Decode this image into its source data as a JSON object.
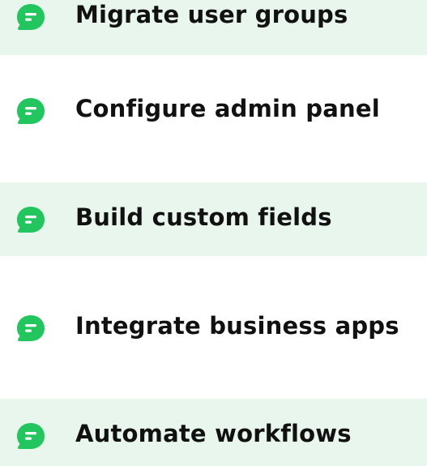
{
  "colors": {
    "accent": "#22c55e",
    "row_tint": "#e8f6ee",
    "text": "#111111"
  },
  "items": [
    {
      "label": "Migrate user groups",
      "icon": "chat-bubble-icon"
    },
    {
      "label": "Configure admin panel",
      "icon": "chat-bubble-icon"
    },
    {
      "label": "Build custom fields",
      "icon": "chat-bubble-icon"
    },
    {
      "label": "Integrate business apps",
      "icon": "chat-bubble-icon"
    },
    {
      "label": "Automate workflows",
      "icon": "chat-bubble-icon"
    }
  ]
}
